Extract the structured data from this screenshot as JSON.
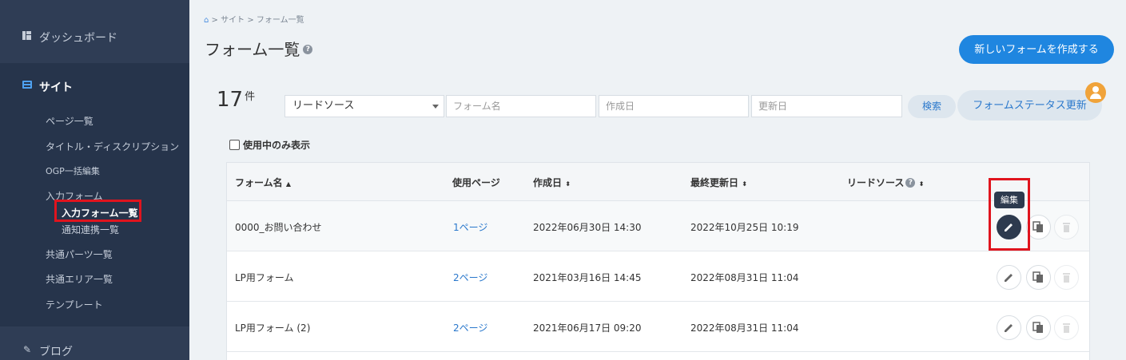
{
  "sidebar": {
    "dashboard": "ダッシュボード",
    "site": "サイト",
    "items": {
      "page_list": "ページ一覧",
      "title_desc": "タイトル・ディスクリプション",
      "ogp": "OGP一括編集",
      "input_form": "入力フォーム",
      "form_list": "入力フォーム一覧",
      "notify": "通知連携一覧",
      "common_parts": "共通パーツ一覧",
      "common_area": "共通エリア一覧",
      "template": "テンプレート"
    },
    "blog": "ブログ"
  },
  "breadcrumb": {
    "home_icon": "home-icon",
    "sep": ">",
    "site": "サイト",
    "current": "フォーム一覧"
  },
  "page": {
    "title": "フォーム一覧",
    "help": "?",
    "new_button": "新しいフォームを作成する"
  },
  "filter": {
    "count": "17",
    "count_unit": "件",
    "lead_source": "リードソース",
    "form_name_placeholder": "フォーム名",
    "created_placeholder": "作成日",
    "updated_placeholder": "更新日",
    "search": "検索",
    "status_update": "フォームステータス更新",
    "only_in_use": "使用中のみ表示"
  },
  "table": {
    "headers": {
      "form_name": "フォーム名",
      "used_page": "使用ページ",
      "created": "作成日",
      "updated": "最終更新日",
      "lead_source": "リードソース"
    },
    "rows": [
      {
        "name": "0000_お問い合わせ",
        "pages": "1ページ",
        "created": "2022年06月30日 14:30",
        "updated": "2022年10月25日 10:19"
      },
      {
        "name": "LP用フォーム",
        "pages": "2ページ",
        "created": "2021年03月16日 14:45",
        "updated": "2022年08月31日 11:04"
      },
      {
        "name": "LP用フォーム (2)",
        "pages": "2ページ",
        "created": "2021年06月17日 09:20",
        "updated": "2022年08月31日 11:04"
      }
    ],
    "tooltip": "編集"
  },
  "colors": {
    "sidebar_bg": "#26344b",
    "accent": "#1f86e0",
    "highlight_box": "#e0141e",
    "avatar": "#f0a33a"
  }
}
